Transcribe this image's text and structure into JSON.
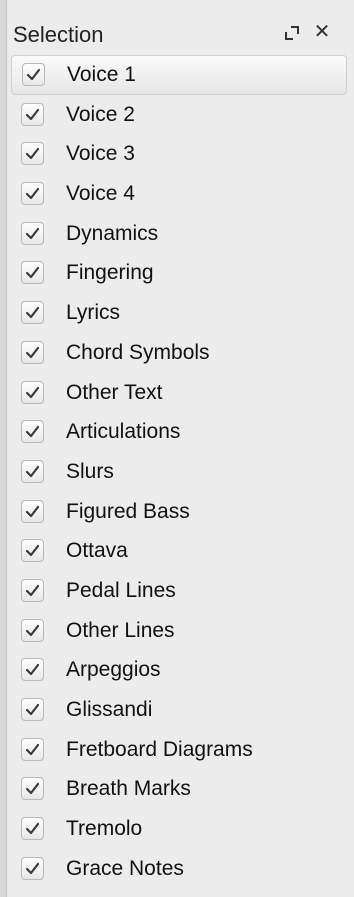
{
  "panel": {
    "title": "Selection",
    "float_icon": "undock-icon",
    "close_icon": "close-icon"
  },
  "items": [
    {
      "label": "Voice 1",
      "checked": true,
      "selected": true
    },
    {
      "label": "Voice 2",
      "checked": true
    },
    {
      "label": "Voice 3",
      "checked": true
    },
    {
      "label": "Voice 4",
      "checked": true
    },
    {
      "label": "Dynamics",
      "checked": true
    },
    {
      "label": "Fingering",
      "checked": true
    },
    {
      "label": "Lyrics",
      "checked": true
    },
    {
      "label": "Chord Symbols",
      "checked": true
    },
    {
      "label": "Other Text",
      "checked": true
    },
    {
      "label": "Articulations",
      "checked": true
    },
    {
      "label": "Slurs",
      "checked": true
    },
    {
      "label": "Figured Bass",
      "checked": true
    },
    {
      "label": "Ottava",
      "checked": true
    },
    {
      "label": "Pedal Lines",
      "checked": true
    },
    {
      "label": "Other Lines",
      "checked": true
    },
    {
      "label": "Arpeggios",
      "checked": true
    },
    {
      "label": "Glissandi",
      "checked": true
    },
    {
      "label": "Fretboard Diagrams",
      "checked": true
    },
    {
      "label": "Breath Marks",
      "checked": true
    },
    {
      "label": "Tremolo",
      "checked": true
    },
    {
      "label": "Grace Notes",
      "checked": true
    }
  ]
}
